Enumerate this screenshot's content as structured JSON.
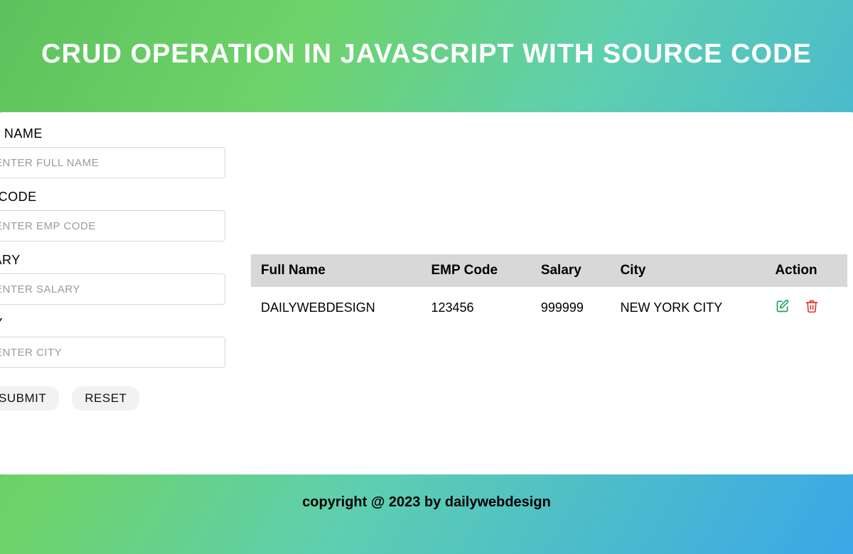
{
  "header": {
    "title": "CRUD OPERATION IN JAVASCRIPT WITH SOURCE CODE"
  },
  "form": {
    "fields": [
      {
        "label": "LL NAME",
        "placeholder": "ENTER FULL NAME"
      },
      {
        "label": "P CODE",
        "placeholder": "ENTER EMP CODE"
      },
      {
        "label": "LARY",
        "placeholder": "ENTER SALARY"
      },
      {
        "label": "TY",
        "placeholder": "ENTER CITY"
      }
    ],
    "submit_label": "SUBMIT",
    "reset_label": "RESET"
  },
  "table": {
    "headers": [
      "Full Name",
      "EMP Code",
      "Salary",
      "City",
      "Action"
    ],
    "rows": [
      {
        "full_name": "DAILYWEBDESIGN",
        "emp_code": "123456",
        "salary": "999999",
        "city": "NEW YORK CITY"
      }
    ]
  },
  "footer": {
    "text": "copyright @ 2023 by dailywebdesign"
  },
  "icons": {
    "edit": "edit-icon",
    "delete": "trash-icon"
  },
  "colors": {
    "edit_icon": "#18a558",
    "delete_icon": "#e43b2f"
  }
}
